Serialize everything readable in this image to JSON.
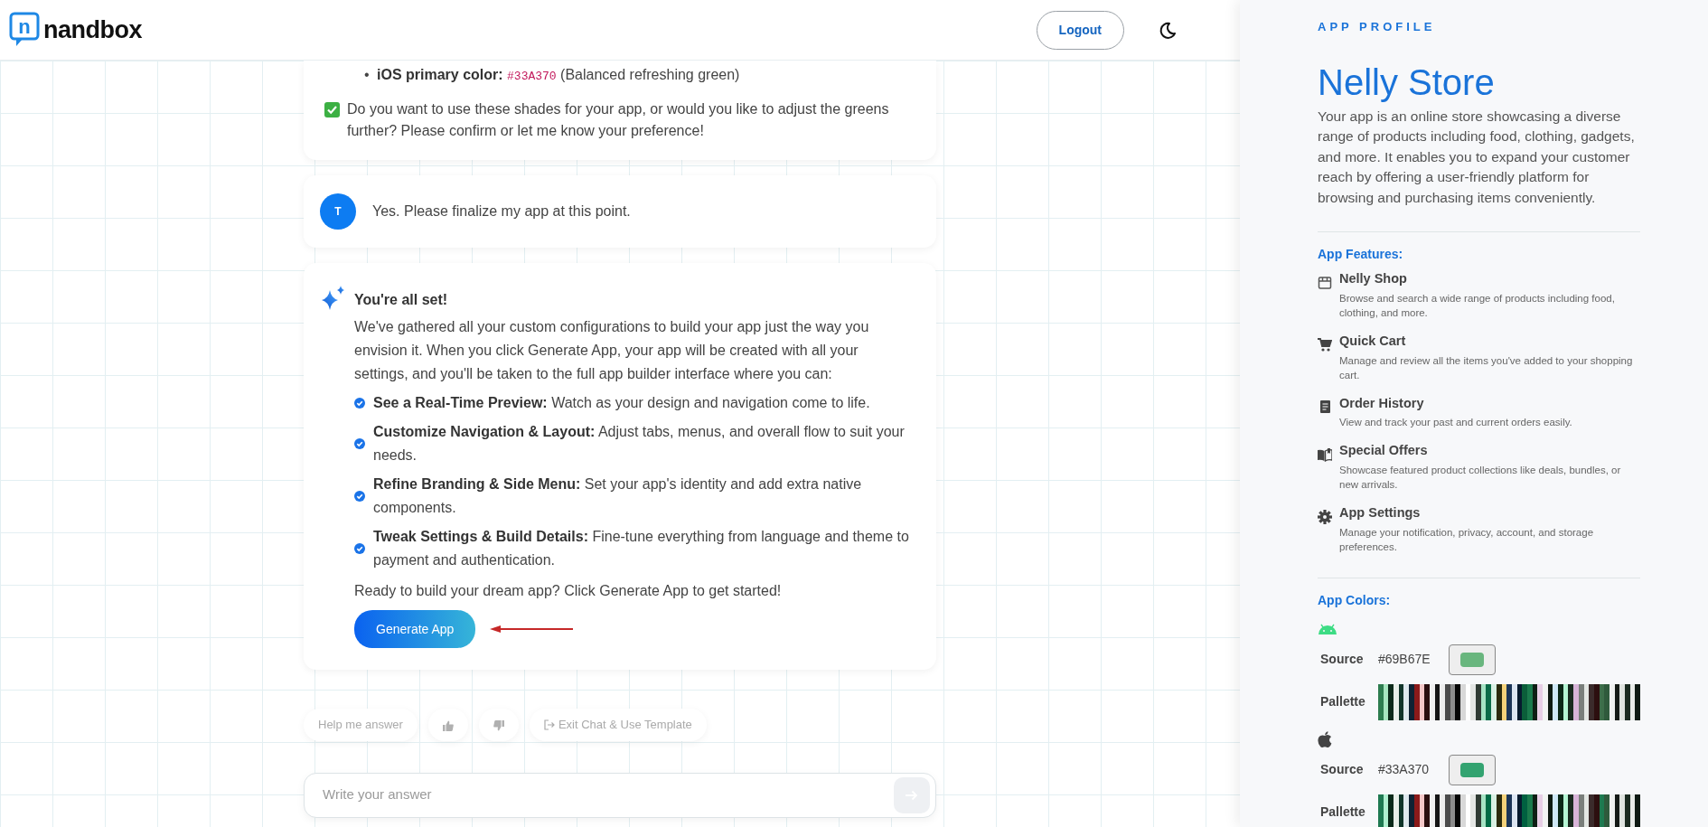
{
  "header": {
    "logo_mark": "n",
    "logo_text": "nandbox",
    "logout": "Logout"
  },
  "messages": [
    {
      "kind": "bot",
      "bullets": [
        {
          "marker": "•",
          "label": "iOS primary color:",
          "code": "#33A370",
          "note": "(Balanced refreshing green)"
        }
      ],
      "confirm": "Do you want to use these shades for your app, or would you like to adjust the greens further? Please confirm or let me know your preference!"
    },
    {
      "kind": "user",
      "avatar": "T",
      "text": "Yes. Please finalize my app at this point."
    },
    {
      "kind": "summary",
      "title": "You're all set!",
      "intro": "We've gathered all your custom configurations to build your app just the way you envision it. When you click Generate App, your app will be created with all your settings, and you'll be taken to the full app builder interface where you can:",
      "checklist": [
        "**See a Real-Time Preview:** Watch as your design and navigation come to life.",
        "**Customize Navigation & Layout:** Adjust tabs, menus, and overall flow to suit your needs.",
        "**Refine Branding & Side Menu:** Set your app's identity and add extra native components.",
        "**Tweak Settings & Build Details:** Fine-tune everything from language and theme to payment and authentication."
      ],
      "outro": "Ready to build your dream app? Click Generate App to get started!",
      "button": "Generate App"
    }
  ],
  "quick_actions": [
    {
      "kind": "text",
      "label": "Help me answer"
    },
    {
      "kind": "thumbs_up"
    },
    {
      "kind": "thumbs_down"
    },
    {
      "kind": "exit",
      "label": "Exit Chat & Use Template"
    }
  ],
  "composer": {
    "placeholder": "Write your answer"
  },
  "profile": {
    "heading": "APP PROFILE",
    "name": "Nelly Store",
    "description": "Your app is an online store showcasing a diverse range of products including food, clothing, gadgets, and more. It enables you to expand your customer reach by offering a user-friendly platform for browsing and purchasing items conveniently.",
    "features_title": "App Features:",
    "features": [
      {
        "kind": "store",
        "title": "Nelly Shop",
        "desc": "Browse and search a wide range of products including food, clothing, and more."
      },
      {
        "kind": "cart",
        "title": "Quick Cart",
        "desc": "Manage and review all the items you've added to your shopping cart."
      },
      {
        "kind": "receipt",
        "title": "Order History",
        "desc": "View and track your past and current orders easily."
      },
      {
        "kind": "book",
        "title": "Special Offers",
        "desc": "Showcase featured product collections like deals, bundles, or new arrivals."
      },
      {
        "kind": "gear",
        "title": "App Settings",
        "desc": "Manage your notification, privacy, account, and storage preferences."
      }
    ],
    "colors_title": "App Colors:",
    "platforms": [
      {
        "kind": "android",
        "source_label": "Source",
        "hex": "#69B67E",
        "color": "#69b67e",
        "palette_label": "Pallette",
        "palette": [
          {
            "color": "#2e7d4f"
          },
          {
            "color": "#a8e6c0"
          },
          {
            "color": "#0d2a1a"
          },
          {
            "color": "#e8efe9"
          },
          {
            "color": "#12352a"
          },
          {
            "color": "#dfe9ee"
          },
          {
            "color": "#0f2233"
          },
          {
            "color": "#8b1a1a"
          },
          {
            "color": "#f4c7c7"
          },
          {
            "color": "#2a0e0e"
          },
          {
            "color": "#f0f0f0"
          },
          {
            "color": "#151515"
          },
          {
            "color": "#eeeeee"
          },
          {
            "color": "#4b4b4b"
          },
          {
            "color": "#8c8c8c"
          },
          {
            "color": "#050505"
          },
          {
            "color": "#d8d8d8"
          },
          {
            "color": "#ffffff"
          },
          {
            "color": "#e4e6e4"
          },
          {
            "color": "#2f3a33"
          },
          {
            "color": "#a6e3c4"
          },
          {
            "color": "#0b6b48"
          },
          {
            "color": "#d9f0e3"
          },
          {
            "color": "#2b2a0d"
          },
          {
            "color": "#f5d27a"
          },
          {
            "color": "#1c3557"
          },
          {
            "color": "#dde6f2"
          },
          {
            "color": "#061a2e"
          },
          {
            "color": "#0b5e3a"
          },
          {
            "color": "#1a7a4c"
          },
          {
            "color": "#0e1f14"
          },
          {
            "color": "#e7cfe5"
          },
          {
            "color": "#f2f4f2"
          },
          {
            "color": "#0e1a11"
          },
          {
            "color": "#cfe8f6"
          },
          {
            "color": "#0c2817"
          },
          {
            "color": "#b5f5d3"
          },
          {
            "color": "#1a2a1f"
          },
          {
            "color": "#d8b4d8"
          },
          {
            "color": "#7a7f7b"
          },
          {
            "color": "#e3e7e3"
          },
          {
            "color": "#3b2b2b"
          },
          {
            "color": "#2c0f0f"
          },
          {
            "color": "#3d6e4a"
          },
          {
            "color": "#2f5a3c"
          },
          {
            "color": "#f0f1f0"
          },
          {
            "color": "#151a16"
          },
          {
            "color": "#dfe3df"
          },
          {
            "color": "#1b2a20"
          },
          {
            "color": "#e9ece9"
          },
          {
            "color": "#0f1a13"
          }
        ]
      },
      {
        "kind": "apple",
        "source_label": "Source",
        "hex": "#33A370",
        "color": "#33a370",
        "palette_label": "Pallette",
        "palette": [
          {
            "color": "#1f7a52"
          },
          {
            "color": "#b0f0d0"
          },
          {
            "color": "#0b2a1a"
          },
          {
            "color": "#e8efe9"
          },
          {
            "color": "#10352a"
          },
          {
            "color": "#dfe9ee"
          },
          {
            "color": "#0f2233"
          },
          {
            "color": "#8b1a1a"
          },
          {
            "color": "#f4c7c7"
          },
          {
            "color": "#2a0e0e"
          },
          {
            "color": "#f0f0f0"
          },
          {
            "color": "#151515"
          },
          {
            "color": "#eeeeee"
          },
          {
            "color": "#4b4b4b"
          },
          {
            "color": "#8c8c8c"
          },
          {
            "color": "#050505"
          },
          {
            "color": "#d8d8d8"
          },
          {
            "color": "#ffffff"
          },
          {
            "color": "#e4e6e4"
          },
          {
            "color": "#2f3a33"
          },
          {
            "color": "#a6e3c4"
          },
          {
            "color": "#006b45"
          },
          {
            "color": "#d9f0e3"
          },
          {
            "color": "#2b2a0d"
          },
          {
            "color": "#f5d27a"
          },
          {
            "color": "#1c3557"
          },
          {
            "color": "#dde6f2"
          },
          {
            "color": "#061a2e"
          },
          {
            "color": "#006040"
          },
          {
            "color": "#1a7a4c"
          },
          {
            "color": "#0e1f14"
          },
          {
            "color": "#e7cfe5"
          },
          {
            "color": "#f2f4f2"
          },
          {
            "color": "#0e1a11"
          },
          {
            "color": "#cfe8f6"
          },
          {
            "color": "#0c2817"
          },
          {
            "color": "#b5f5d3"
          },
          {
            "color": "#1a2a1f"
          },
          {
            "color": "#d8b4d8"
          },
          {
            "color": "#7a7f7b"
          },
          {
            "color": "#e3e7e3"
          },
          {
            "color": "#3b2b2b"
          },
          {
            "color": "#2c0f0f"
          },
          {
            "color": "#1e7a50"
          },
          {
            "color": "#2f5a3c"
          },
          {
            "color": "#f0f1f0"
          },
          {
            "color": "#151a16"
          },
          {
            "color": "#dfe3df"
          },
          {
            "color": "#1b2a20"
          },
          {
            "color": "#e9ece9"
          },
          {
            "color": "#0f1a13"
          }
        ]
      }
    ]
  }
}
